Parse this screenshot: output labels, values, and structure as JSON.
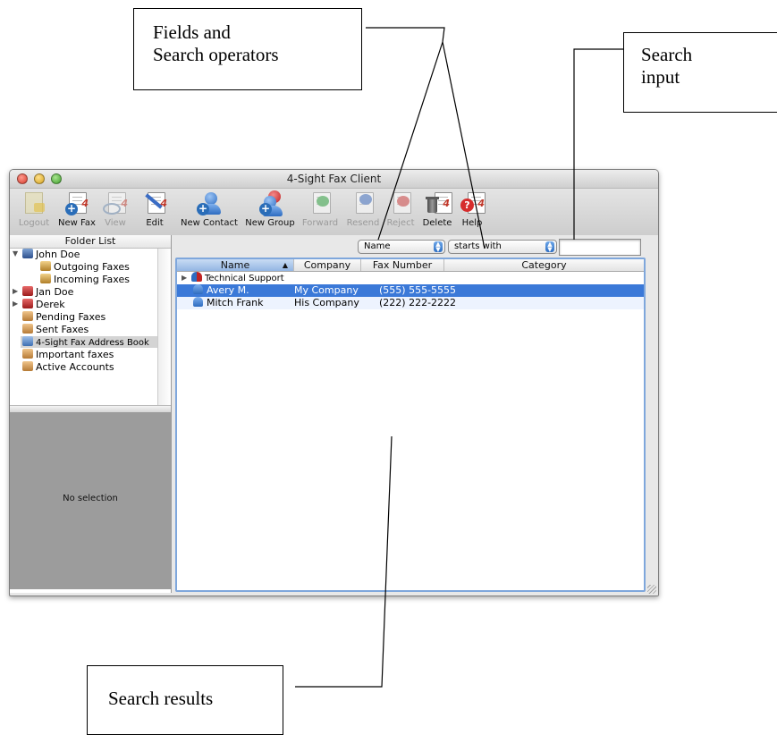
{
  "annotations": {
    "fields_operators": [
      "Fields and",
      "Search operators"
    ],
    "search_input": [
      "Search",
      "input"
    ],
    "search_results": "Search results"
  },
  "window": {
    "title": "4-Sight Fax Client"
  },
  "toolbar": {
    "logout": "Logout",
    "new_fax": "New Fax",
    "view": "View",
    "edit": "Edit",
    "new_contact": "New Contact",
    "new_group": "New Group",
    "forward": "Forward",
    "resend": "Resend",
    "reject": "Reject",
    "delete": "Delete",
    "help": "Help"
  },
  "sidebar": {
    "header": "Folder List",
    "items": [
      "John Doe",
      "Outgoing Faxes",
      "Incoming Faxes",
      "Jan Doe",
      "Derek",
      "Pending Faxes",
      "Sent Faxes",
      "4-Sight Fax Address Book",
      "Important faxes",
      "Active Accounts"
    ],
    "no_selection": "No selection"
  },
  "search": {
    "field": "Name",
    "operator": "starts with",
    "value": ""
  },
  "table": {
    "columns": [
      "Name",
      "Company",
      "Fax Number",
      "Category"
    ],
    "rows": [
      {
        "name": "Technical Support",
        "company": "",
        "fax": "",
        "category": ""
      },
      {
        "name": "Avery M.",
        "company": "My Company",
        "fax": "(555) 555-5555",
        "category": ""
      },
      {
        "name": "Mitch Frank",
        "company": "His Company",
        "fax": "(222) 222-2222",
        "category": ""
      }
    ]
  }
}
